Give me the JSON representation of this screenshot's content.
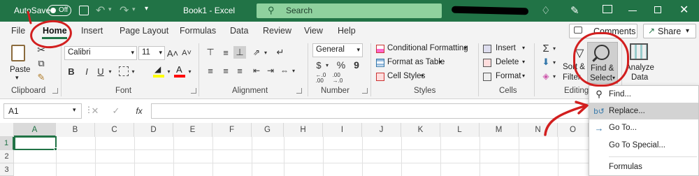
{
  "titlebar": {
    "autosave_label": "AutoSave",
    "autosave_state": "Off",
    "doc_title": "Book1  -  Excel",
    "search_placeholder": "Search"
  },
  "tabs": [
    "File",
    "Home",
    "Insert",
    "Page Layout",
    "Formulas",
    "Data",
    "Review",
    "View",
    "Help"
  ],
  "share": {
    "comments": "Comments",
    "share": "Share"
  },
  "clipboard": {
    "paste": "Paste",
    "group": "Clipboard"
  },
  "font": {
    "name": "Calibri",
    "size": "11",
    "bold": "B",
    "italic": "I",
    "underline": "U",
    "grow": "A˄",
    "shrink": "A˅",
    "color_letter": "A",
    "group": "Font"
  },
  "alignment": {
    "group": "Alignment"
  },
  "number": {
    "format": "General",
    "currency": "$",
    "percent": "%",
    "comma": "9",
    "group": "Number"
  },
  "styles": {
    "cond": "Conditional Formatting",
    "table": "Format as Table",
    "cell": "Cell Styles",
    "group": "Styles"
  },
  "cells": {
    "insert": "Insert",
    "delete": "Delete",
    "format": "Format",
    "group": "Cells"
  },
  "editing": {
    "sort": "Sort &",
    "filter": "Filter",
    "find1": "Find &",
    "find2": "Select",
    "group": "Editing"
  },
  "analyze": {
    "line1": "Analyze",
    "line2": "Data"
  },
  "formula": {
    "namebox": "A1",
    "fx": "fx"
  },
  "columns": [
    "A",
    "B",
    "C",
    "D",
    "E",
    "F",
    "G",
    "H",
    "I",
    "J",
    "K",
    "L",
    "M",
    "N",
    "O"
  ],
  "rows": [
    "1",
    "2",
    "3"
  ],
  "menu": [
    "Find...",
    "Replace...",
    "Go To...",
    "Go To Special...",
    "Formulas"
  ],
  "colors": {
    "excel_green": "#217346",
    "highlight_red": "#d21f1f",
    "font_color_bar": "#ff0000",
    "fill_color_bar": "#ffff00"
  }
}
